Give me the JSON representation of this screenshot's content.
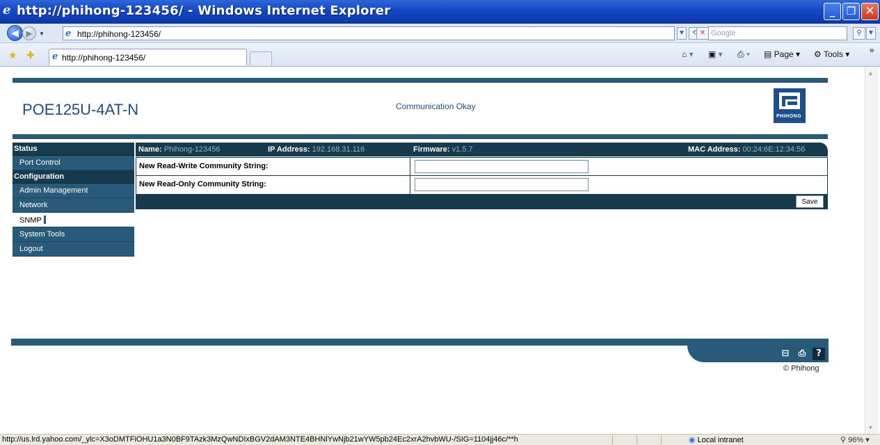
{
  "window": {
    "title": "http://phihong-123456/ - Windows Internet Explorer",
    "ie_glyph": "e",
    "min": "_",
    "max": "❐",
    "close": "✕"
  },
  "addressbar": {
    "url": "http://phihong-123456/",
    "search_placeholder": "Google"
  },
  "tabbar": {
    "tab_label": "http://phihong-123456/",
    "page_menu": "Page",
    "tools_menu": "Tools"
  },
  "page": {
    "device_name": "POE125U-4AT-N",
    "comm_status": "Communication Okay",
    "logo_text": "PHIHONG"
  },
  "sidebar": {
    "sections": [
      {
        "title": "Status",
        "items": [
          {
            "label": "Port Control"
          }
        ]
      },
      {
        "title": "Configuration",
        "items": [
          {
            "label": "Admin Management"
          },
          {
            "label": "Network"
          },
          {
            "label": "SNMP",
            "active": true
          },
          {
            "label": "System Tools"
          },
          {
            "label": "Logout"
          }
        ]
      }
    ]
  },
  "infobar": {
    "name_label": "Name:",
    "name_value": "Phihong-123456",
    "ip_label": "IP Address:",
    "ip_value": "192.168.31.116",
    "fw_label": "Firmware:",
    "fw_value": "v1.5.7",
    "mac_label": "MAC Address:",
    "mac_value": "00:24:6E:12:34:56"
  },
  "form": {
    "rw_label": "New Read-Write Community String:",
    "rw_value": "",
    "ro_label": "New Read-Only Community String:",
    "ro_value": "",
    "save_label": "Save"
  },
  "footer": {
    "copyright": "© Phihong",
    "help": "?"
  },
  "statusbar": {
    "url": "http://us.lrd.yahoo.com/_ylc=X3oDMTFiOHU1a3N0BF9TAzk3MzQwNDIxBGV2dAM3NTE4BHNlYwNjb21wYW5pb24Ec2xrA2hvbWU-/SIG=1104jj46c/**h",
    "zone": "Local intranet",
    "zoom": "96%"
  },
  "colors": {
    "nav_dark": "#173a4d",
    "nav_item": "#285a7a",
    "title_blue": "#1f4d80"
  }
}
